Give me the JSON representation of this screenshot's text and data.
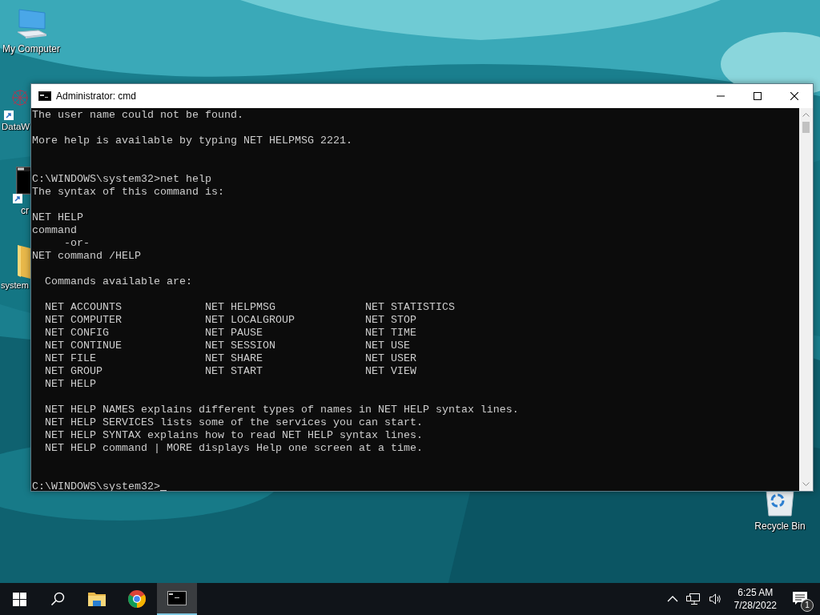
{
  "desktop_icons": [
    {
      "kind": "computer",
      "label": "My Computer"
    },
    {
      "kind": "network",
      "label": "DataW"
    },
    {
      "kind": "console",
      "label": "cr"
    },
    {
      "kind": "folder",
      "label": "system"
    },
    {
      "kind": "recycle",
      "label": "Recycle Bin"
    }
  ],
  "window": {
    "title": "Administrator: cmd"
  },
  "console": {
    "lines": [
      {
        "kind": "line",
        "text": "The user name could not be found."
      },
      {
        "kind": "blank"
      },
      {
        "kind": "line",
        "text": "More help is available by typing NET HELPMSG 2221."
      },
      {
        "kind": "blank"
      },
      {
        "kind": "blank"
      },
      {
        "kind": "line",
        "text": "C:\\WINDOWS\\system32>net help"
      },
      {
        "kind": "line",
        "text": "The syntax of this command is:"
      },
      {
        "kind": "blank"
      },
      {
        "kind": "line",
        "text": "NET HELP"
      },
      {
        "kind": "line",
        "text": "command"
      },
      {
        "kind": "line",
        "text": "     -or-"
      },
      {
        "kind": "line",
        "text": "NET command /HELP"
      },
      {
        "kind": "blank"
      },
      {
        "kind": "line",
        "text": "  Commands available are:"
      },
      {
        "kind": "blank"
      },
      {
        "kind": "columns",
        "rows": [
          [
            "NET ACCOUNTS",
            "NET HELPMSG",
            "NET STATISTICS"
          ],
          [
            "NET COMPUTER",
            "NET LOCALGROUP",
            "NET STOP"
          ],
          [
            "NET CONFIG",
            "NET PAUSE",
            "NET TIME"
          ],
          [
            "NET CONTINUE",
            "NET SESSION",
            "NET USE"
          ],
          [
            "NET FILE",
            "NET SHARE",
            "NET USER"
          ],
          [
            "NET GROUP",
            "NET START",
            "NET VIEW"
          ],
          [
            "NET HELP"
          ]
        ]
      },
      {
        "kind": "blank"
      },
      {
        "kind": "line",
        "text": "  NET HELP NAMES explains different types of names in NET HELP syntax lines."
      },
      {
        "kind": "line",
        "text": "  NET HELP SERVICES lists some of the services you can start."
      },
      {
        "kind": "line",
        "text": "  NET HELP SYNTAX explains how to read NET HELP syntax lines."
      },
      {
        "kind": "line",
        "text": "  NET HELP command | MORE displays Help one screen at a time."
      },
      {
        "kind": "blank"
      },
      {
        "kind": "blank"
      },
      {
        "kind": "prompt",
        "text": "C:\\WINDOWS\\system32>"
      }
    ]
  },
  "taskbar": {
    "apps": [
      {
        "kind": "explorer",
        "selected": false
      },
      {
        "kind": "chrome",
        "selected": false
      },
      {
        "kind": "console",
        "selected": true
      }
    ],
    "clock": {
      "time": "6:25 AM",
      "date": "7/28/2022"
    },
    "notifications": {
      "count": "1"
    }
  }
}
